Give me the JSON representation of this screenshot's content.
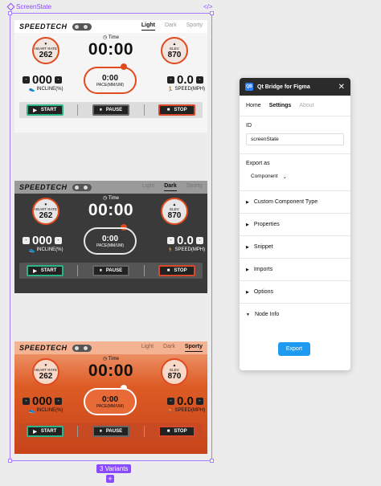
{
  "canvas": {
    "set_label": "ScreenState",
    "code_icon": "</>",
    "variants_badge": "3 Variants",
    "add_button": "+"
  },
  "variant": {
    "brand": "SPEEDTECH",
    "themes": [
      "Light",
      "Dark",
      "Sporty"
    ],
    "heart_label": "HEART RATE",
    "heart_value": "262",
    "time_label": "Time",
    "time_value": "00:00",
    "elev_label": "ELEV",
    "elev_value": "870",
    "incline_value": "000",
    "incline_label": "INCLINE(%)",
    "pace_value": "0:00",
    "pace_label": "PACE(MM/UM)",
    "speed_value": "0.0",
    "speed_label": "SPEED(MPH)",
    "start": "START",
    "pause": "PAUSE",
    "stop": "STOP",
    "minus": "-"
  },
  "panel": {
    "title": "Qt Bridge for Figma",
    "logo": "QB",
    "close": "✕",
    "tabs": [
      "Home",
      "Settings",
      "About"
    ],
    "id_label": "ID",
    "id_value": "screenState",
    "export_as_label": "Export as",
    "export_as_value": "Component",
    "sections": [
      "Custom Component Type",
      "Properties",
      "Snippet",
      "Imports",
      "Options",
      "Node Info"
    ],
    "export_button": "Export"
  },
  "colors": {
    "accent_purple": "#8a4bff",
    "accent_orange": "#e04a1f",
    "export_blue": "#1e9bf0"
  },
  "icons": [
    "search-icon",
    "close-icon",
    "chevron-right-icon",
    "chevron-down-icon",
    "play-icon",
    "pause-icon",
    "stop-icon",
    "heart-icon",
    "clock-icon",
    "mountain-icon",
    "shoe-icon",
    "runner-icon"
  ]
}
